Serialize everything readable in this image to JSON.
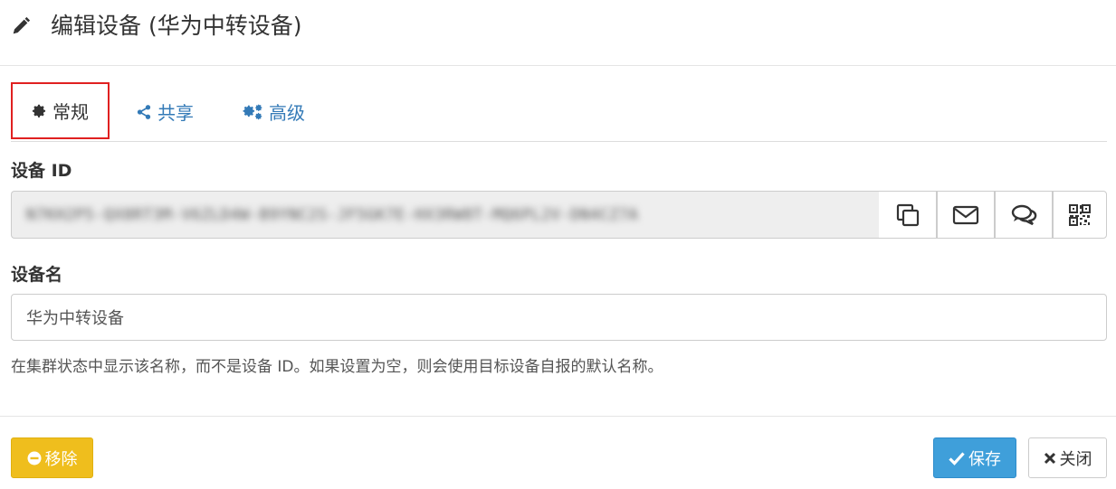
{
  "header": {
    "title": "编辑设备 (华为中转设备)"
  },
  "tabs": [
    {
      "label": "常规",
      "active": true
    },
    {
      "label": "共享",
      "active": false
    },
    {
      "label": "高级",
      "active": false
    }
  ],
  "form": {
    "device_id_label": "设备 ID",
    "device_id_value": "N7KH2P5-QX8RT3M-V6ZLD4W-B9YNC2S-JF5GK7E-HX3RW8T-MQ6PL2V-DN4CZ7A",
    "device_id_actions": [
      "copy-icon",
      "envelope-icon",
      "comments-icon",
      "qrcode-icon"
    ],
    "device_name_label": "设备名",
    "device_name_value": "华为中转设备",
    "help_text": "在集群状态中显示该名称，而不是设备 ID。如果设置为空，则会使用目标设备自报的默认名称。"
  },
  "footer": {
    "remove_label": "移除",
    "save_label": "保存",
    "close_label": "关闭"
  },
  "colors": {
    "link": "#337ab7",
    "highlight_border": "#e02020",
    "remove_bg": "#efbe1d",
    "save_bg": "#3f9fda"
  }
}
